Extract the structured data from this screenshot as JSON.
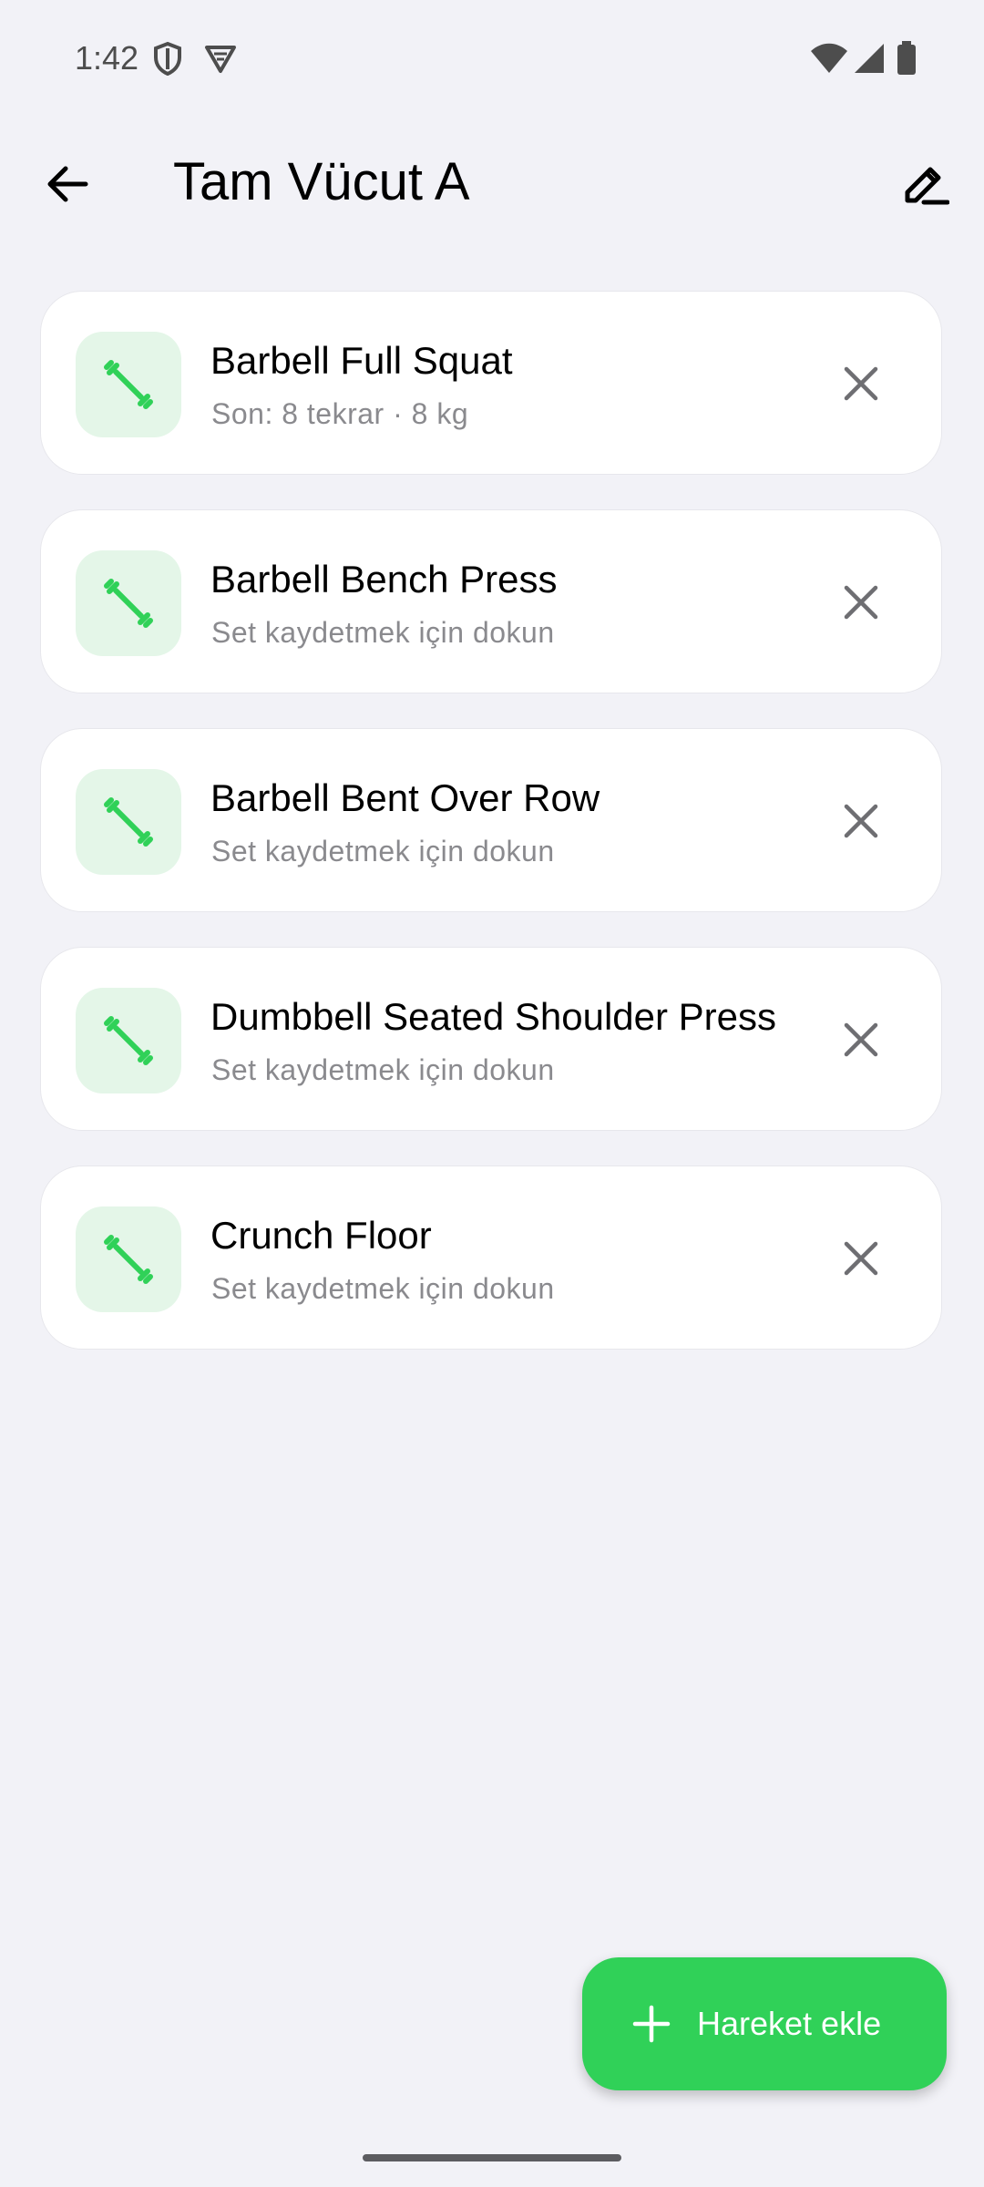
{
  "status_bar": {
    "time": "1:42",
    "icons": [
      "shield-icon",
      "vpn-icon",
      "wifi-icon",
      "signal-icon",
      "battery-icon"
    ]
  },
  "header": {
    "title": "Tam Vücut A",
    "back_icon": "arrow-left-icon",
    "edit_icon": "pencil-icon"
  },
  "exercises": [
    {
      "name": "Barbell Full Squat",
      "subtitle": "Son: 8 tekrar · 8 kg",
      "icon": "dumbbell-icon"
    },
    {
      "name": "Barbell Bench Press",
      "subtitle": "Set kaydetmek için dokun",
      "icon": "dumbbell-icon"
    },
    {
      "name": "Barbell Bent Over Row",
      "subtitle": "Set kaydetmek için dokun",
      "icon": "dumbbell-icon"
    },
    {
      "name": "Dumbbell Seated Shoulder Press",
      "subtitle": "Set kaydetmek için dokun",
      "icon": "dumbbell-icon"
    },
    {
      "name": "Crunch Floor",
      "subtitle": "Set kaydetmek için dokun",
      "icon": "dumbbell-icon"
    }
  ],
  "fab": {
    "label": "Hareket ekle",
    "icon": "plus-icon"
  },
  "colors": {
    "accent": "#30d158",
    "icon_bg": "#e4f6e8",
    "background": "#f2f2f7"
  }
}
